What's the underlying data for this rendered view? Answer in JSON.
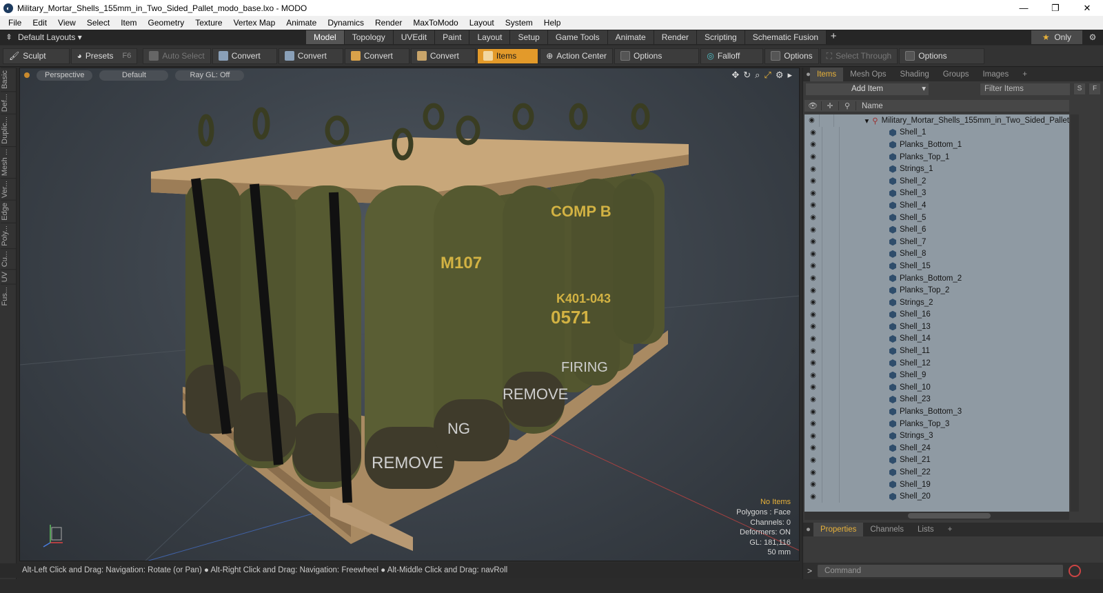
{
  "window": {
    "title": "Military_Mortar_Shells_155mm_in_Two_Sided_Pallet_modo_base.lxo - MODO",
    "min": "—",
    "max": "❐",
    "close": "✕"
  },
  "menu": [
    "File",
    "Edit",
    "View",
    "Select",
    "Item",
    "Geometry",
    "Texture",
    "Vertex Map",
    "Animate",
    "Dynamics",
    "Render",
    "MaxToModo",
    "Layout",
    "System",
    "Help"
  ],
  "layouts": {
    "label": "Default Layouts ▾",
    "tabs": [
      "Model",
      "Topology",
      "UVEdit",
      "Paint",
      "Layout",
      "Setup",
      "Game Tools",
      "Animate",
      "Render",
      "Scripting",
      "Schematic Fusion"
    ],
    "active": "Model",
    "only": "Only"
  },
  "toolbar": {
    "sculpt": "Sculpt",
    "presets": "Presets",
    "presets_key": "F6",
    "auto_select": "Auto Select",
    "convert": "Convert",
    "items": "Items",
    "action_center": "Action Center",
    "options": "Options",
    "falloff": "Falloff",
    "select_through": "Select Through"
  },
  "left_tabs": [
    "Basic",
    "Def...",
    "Duplic...",
    "Mesh ...",
    "Ver...",
    "Edge",
    "Poly...",
    "Cu...",
    "UV",
    "Fus..."
  ],
  "viewport": {
    "perspective": "Perspective",
    "default": "Default",
    "raygl": "Ray GL: Off"
  },
  "info": {
    "no_items": "No Items",
    "polygons": "Polygons : Face",
    "channels": "Channels: 0",
    "deformers": "Deformers: ON",
    "gl": "GL: 181,116",
    "mm": "50 mm"
  },
  "status": "Alt-Left Click and Drag: Navigation: Rotate (or Pan) ● Alt-Right Click and Drag: Navigation: Freewheel ● Alt-Middle Click and Drag: navRoll",
  "panel": {
    "tabs": [
      "Items",
      "Mesh Ops",
      "Shading",
      "Groups",
      "Images"
    ],
    "add_item": "Add Item",
    "filter": "Filter Items",
    "s": "S",
    "f": "F",
    "name_col": "Name",
    "root": "Military_Mortar_Shells_155mm_in_Two_Sided_Pallet",
    "items": [
      "Shell_1",
      "Planks_Bottom_1",
      "Planks_Top_1",
      "Strings_1",
      "Shell_2",
      "Shell_3",
      "Shell_4",
      "Shell_5",
      "Shell_6",
      "Shell_7",
      "Shell_8",
      "Shell_15",
      "Planks_Bottom_2",
      "Planks_Top_2",
      "Strings_2",
      "Shell_16",
      "Shell_13",
      "Shell_14",
      "Shell_11",
      "Shell_12",
      "Shell_9",
      "Shell_10",
      "Shell_23",
      "Planks_Bottom_3",
      "Planks_Top_3",
      "Strings_3",
      "Shell_24",
      "Shell_21",
      "Shell_22",
      "Shell_19",
      "Shell_20"
    ],
    "bottom_tabs": [
      "Properties",
      "Channels",
      "Lists"
    ],
    "command": "Command"
  },
  "shell_text": {
    "a": "COMP B",
    "b": "M107",
    "c": "K401-043",
    "d": "0571",
    "e": "REMOVE",
    "f": "FIRING",
    "g": "NG"
  }
}
